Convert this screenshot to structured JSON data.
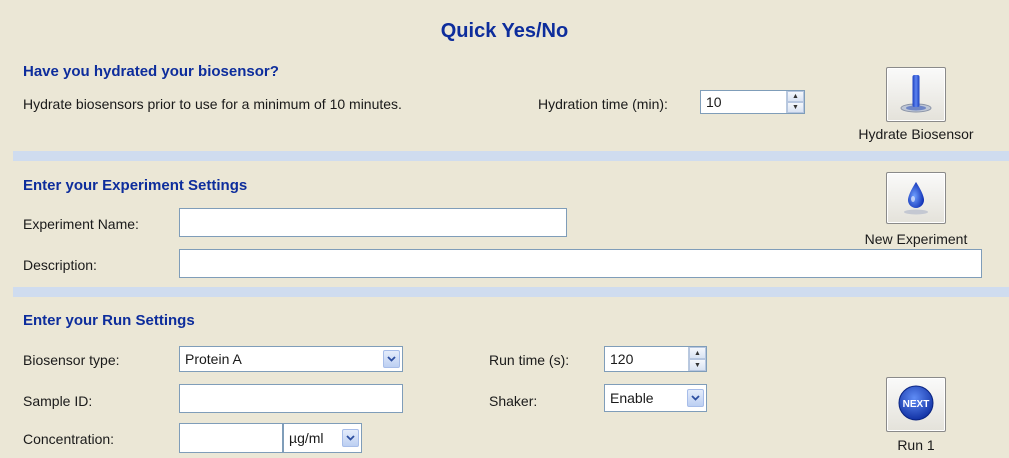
{
  "title": "Quick Yes/No",
  "hydrate": {
    "heading": "Have you hydrated your biosensor?",
    "instruction": "Hydrate biosensors prior to use for a minimum of 10 minutes.",
    "time_label": "Hydration time (min):",
    "time_value": "10",
    "button_label": "Hydrate Biosensor",
    "button_icon": "biosensor-probe-icon"
  },
  "experiment": {
    "heading": "Enter your Experiment Settings",
    "name_label": "Experiment Name:",
    "name_value": "",
    "description_label": "Description:",
    "description_value": "",
    "button_label": "New Experiment",
    "button_icon": "droplet-icon"
  },
  "run": {
    "heading": "Enter your Run Settings",
    "biosensor_label": "Biosensor type:",
    "biosensor_value": "Protein A",
    "sample_label": "Sample ID:",
    "sample_value": "",
    "concentration_label": "Concentration:",
    "concentration_value": "",
    "concentration_unit": "µg/ml",
    "runtime_label": "Run time (s):",
    "runtime_value": "120",
    "shaker_label": "Shaker:",
    "shaker_value": "Enable",
    "button_label": "Run 1",
    "button_icon": "next-icon",
    "button_icon_text": "NEXT"
  },
  "colors": {
    "background": "#ebe7d6",
    "heading": "#0d2d9c",
    "divider": "#cfdcef",
    "field_border": "#7f9db9"
  }
}
